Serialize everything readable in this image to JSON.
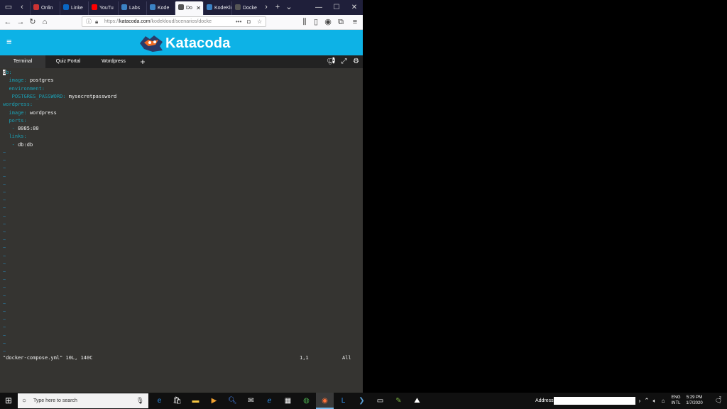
{
  "browser": {
    "tabs": [
      {
        "label": "Onlin",
        "color": "#cc3333"
      },
      {
        "label": "Linke",
        "color": "#0a66c2"
      },
      {
        "label": "YouTu",
        "color": "#ff0000"
      },
      {
        "label": "Labs",
        "color": "#3b82c4"
      },
      {
        "label": "Kode",
        "color": "#3b82c4"
      },
      {
        "label": "Do",
        "color": "#555555"
      },
      {
        "label": "KodeKlou",
        "color": "#3b82c4"
      },
      {
        "label": "Docke",
        "color": "#555555"
      }
    ],
    "url_prefix": "https://",
    "url_domain": "katacoda.com",
    "url_path": "/kodekloud/scenarios/docke"
  },
  "header": {
    "logo_text": "Katacoda"
  },
  "toolbar": {
    "tabs": [
      "Terminal",
      "Quiz Portal",
      "Wordpress"
    ],
    "add_label": "+"
  },
  "terminal": {
    "lines": [
      {
        "key": "db:",
        "value": "",
        "indent": ""
      },
      {
        "key": "image:",
        "value": " postgres",
        "indent": "  "
      },
      {
        "key": "environment:",
        "value": "",
        "indent": "  "
      },
      {
        "key": "POSTGRES_PASSWORD:",
        "value": " mysecretpassword",
        "indent": "   "
      },
      {
        "key": "wordpress:",
        "value": "",
        "indent": ""
      },
      {
        "key": "image:",
        "value": " wordpress",
        "indent": "  "
      },
      {
        "key": "ports:",
        "value": "",
        "indent": "  "
      },
      {
        "key": "-",
        "value": " 8085:80",
        "indent": "   "
      },
      {
        "key": "links:",
        "value": "",
        "indent": "  "
      },
      {
        "key": "-",
        "value": " db:db",
        "indent": "   "
      }
    ],
    "tilde": "~",
    "status_file": "\"docker-compose.yml\" 10L, 140C",
    "status_pos": "1,1",
    "status_all": "All"
  },
  "taskbar": {
    "search_placeholder": "Type here to search",
    "address_label": "Address",
    "lang_top": "ENG",
    "lang_bottom": "INTL",
    "time": "5:29 PM",
    "date": "1/7/2020",
    "notification_count": "2"
  }
}
